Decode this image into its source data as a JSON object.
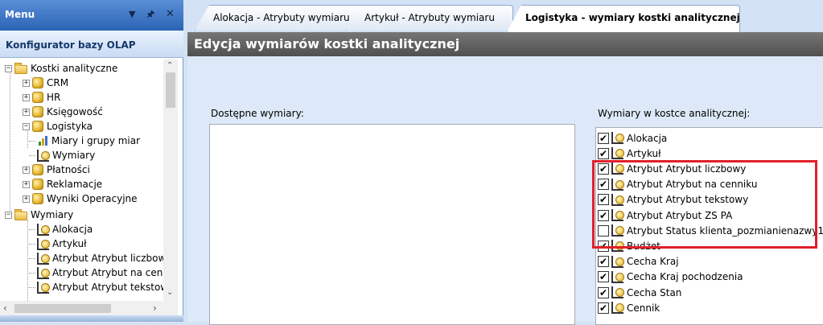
{
  "menu": {
    "title": "Menu",
    "pin_icon": "pin-icon",
    "dropdown_icon": "triangle-down-icon",
    "close_icon": "close-icon",
    "subtitle": "Konfigurator bazy OLAP"
  },
  "tree": {
    "root": "Kostki analityczne",
    "cubes": [
      "CRM",
      "HR",
      "Księgowość",
      "Logistyka"
    ],
    "logistyka_children": [
      "Miary i grupy miar",
      "Wymiary"
    ],
    "cubes_after": [
      "Płatności",
      "Reklamacje",
      "Wyniki Operacyjne"
    ],
    "wymiary_root": "Wymiary",
    "wymiary_children": [
      "Alokacja",
      "Artykuł",
      "Atrybut Atrybut liczbowy",
      "Atrybut Atrybut na cenn",
      "Atrybut Atrybut tekstow"
    ]
  },
  "tabs": [
    {
      "label": "Alokacja - Atrybuty wymiaru"
    },
    {
      "label": "Artykuł - Atrybuty wymiaru"
    },
    {
      "label": "Logistyka - wymiary kostki analitycznej"
    }
  ],
  "content": {
    "header": "Edycja wymiarów kostki analitycznej",
    "available_label": "Dostępne wymiary:",
    "in_cube_label": "Wymiary w kostce analitycznej:",
    "dimensions": [
      {
        "label": "Alokacja",
        "checked": true
      },
      {
        "label": "Artykuł",
        "checked": true
      },
      {
        "label": "Atrybut Atrybut liczbowy",
        "checked": true
      },
      {
        "label": "Atrybut Atrybut na cenniku",
        "checked": true
      },
      {
        "label": "Atrybut Atrybut tekstowy",
        "checked": true
      },
      {
        "label": "Atrybut Atrybut ZS PA",
        "checked": true
      },
      {
        "label": "Atrybut Status klienta_pozmianienazwy1",
        "checked": false
      },
      {
        "label": "Budżet",
        "checked": true
      },
      {
        "label": "Cecha Kraj",
        "checked": true
      },
      {
        "label": "Cecha Kraj pochodzenia",
        "checked": true
      },
      {
        "label": "Cecha Stan",
        "checked": true
      },
      {
        "label": "Cennik",
        "checked": true
      }
    ]
  },
  "colors": {
    "highlight": "#e0202a",
    "header_bg": "#505050",
    "menu_header": "#2b63b5"
  }
}
